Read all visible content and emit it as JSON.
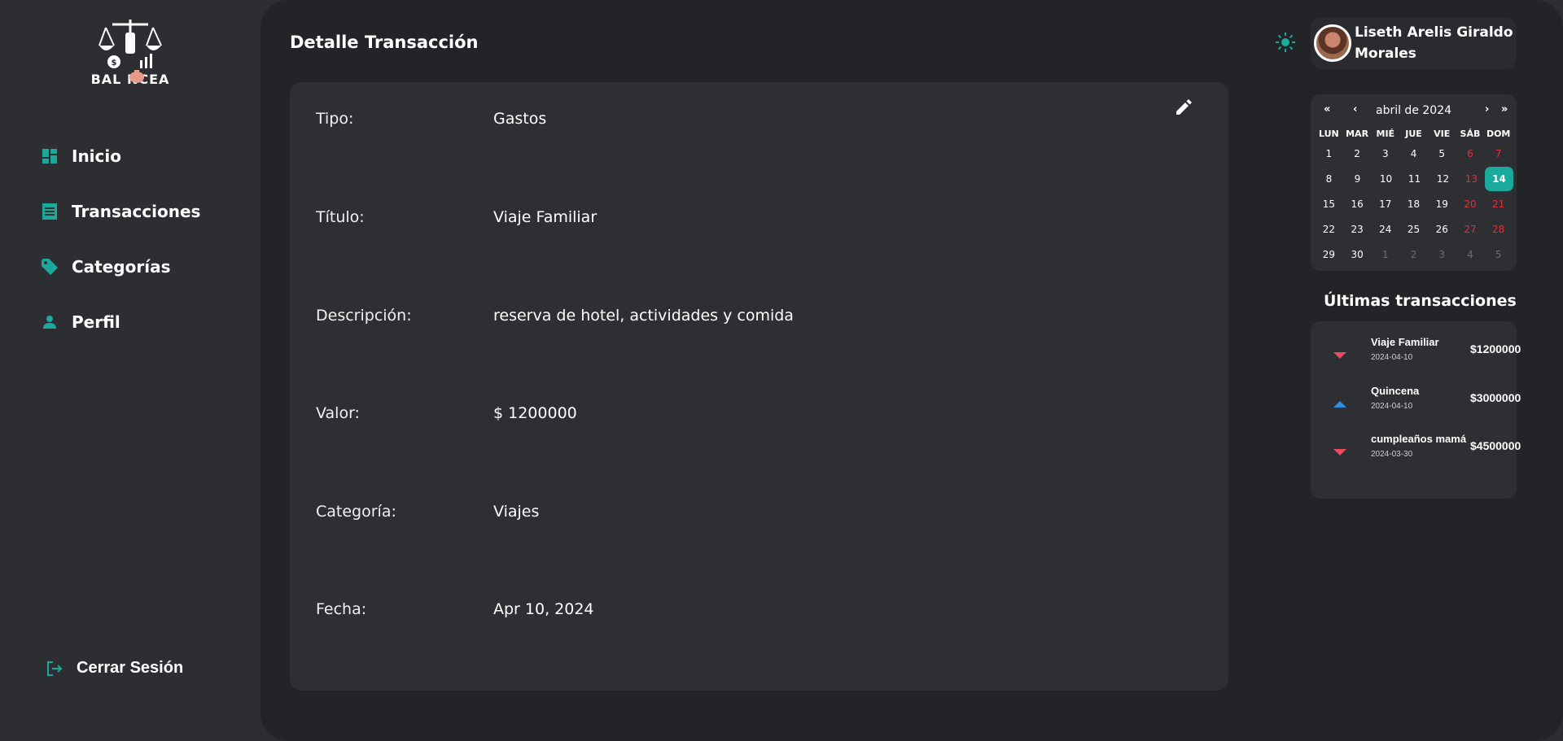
{
  "brand": {
    "logo_text": "BAL NCEA",
    "accent": "#1aa99b"
  },
  "sidebar": {
    "items": [
      {
        "label": "Inicio",
        "icon": "dashboard-icon"
      },
      {
        "label": "Transacciones",
        "icon": "receipt-icon"
      },
      {
        "label": "Categorías",
        "icon": "tag-icon"
      },
      {
        "label": "Perfil",
        "icon": "person-icon"
      }
    ],
    "logout_label": "Cerrar Sesión"
  },
  "header": {
    "title": "Detalle Transacción",
    "user_name": "Liseth Arelis Giraldo Morales"
  },
  "detail": {
    "fields": [
      {
        "key": "Tipo:",
        "value": "Gastos"
      },
      {
        "key": "Título:",
        "value": "Viaje Familiar"
      },
      {
        "key": "Descripción:",
        "value": "reserva de hotel, actividades y comida"
      },
      {
        "key": "Valor:",
        "value": "$ 1200000"
      },
      {
        "key": "Categoría:",
        "value": "Viajes"
      },
      {
        "key": "Fecha:",
        "value": "Apr 10, 2024"
      }
    ]
  },
  "calendar": {
    "month_label": "abril de 2024",
    "nav": {
      "prev_year": "«",
      "prev_month": "‹",
      "next_month": "›",
      "next_year": "»"
    },
    "weekdays": [
      "LUN",
      "MAR",
      "MIÉ",
      "JUE",
      "VIE",
      "SÁB",
      "DOM"
    ],
    "weeks": [
      [
        "1",
        "2",
        "3",
        "4",
        "5",
        "6",
        "7"
      ],
      [
        "8",
        "9",
        "10",
        "11",
        "12",
        "13",
        "14"
      ],
      [
        "15",
        "16",
        "17",
        "18",
        "19",
        "20",
        "21"
      ],
      [
        "22",
        "23",
        "24",
        "25",
        "26",
        "27",
        "28"
      ],
      [
        "29",
        "30",
        "1",
        "2",
        "3",
        "4",
        "5"
      ]
    ],
    "selected_day": "14",
    "weekend_color": "#e0303a"
  },
  "recent": {
    "title": "Últimas transacciones",
    "items": [
      {
        "name": "Viaje Familiar",
        "date": "2024-04-10",
        "amount": "$1200000",
        "direction": "down"
      },
      {
        "name": "Quincena",
        "date": "2024-04-10",
        "amount": "$3000000",
        "direction": "up"
      },
      {
        "name": "cumpleaños mamá",
        "date": "2024-03-30",
        "amount": "$4500000",
        "direction": "down"
      }
    ],
    "colors": {
      "down": "#e94a5f",
      "up": "#2f8fe0"
    }
  }
}
